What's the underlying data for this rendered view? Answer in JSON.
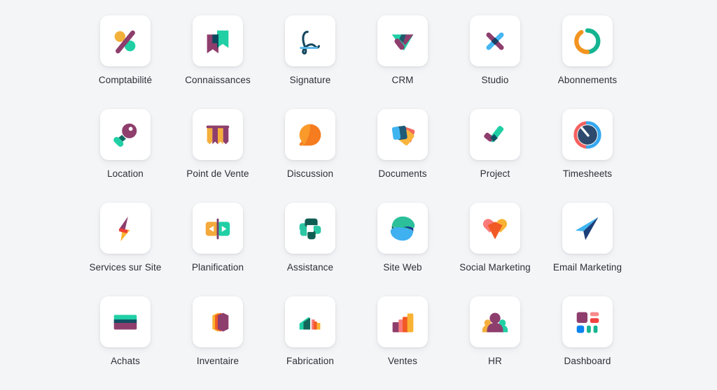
{
  "page": {
    "background_color": "#f4f5f7",
    "label_color": "#2b2f36",
    "tile_color": "#ffffff",
    "columns": 6,
    "rows": 4
  },
  "apps": [
    {
      "label": "Comptabilité",
      "icon": "accounting-percent-icon",
      "colors": [
        "#f2b13b",
        "#8e3e6d",
        "#21cfa5"
      ]
    },
    {
      "label": "Connaissances",
      "icon": "knowledge-bookmark-icon",
      "colors": [
        "#21cfa5",
        "#8e3e6d",
        "#0b4a5e"
      ]
    },
    {
      "label": "Signature",
      "icon": "signature-pen-icon",
      "colors": [
        "#14475e",
        "#5ab8ea"
      ]
    },
    {
      "label": "CRM",
      "icon": "crm-handshake-icon",
      "colors": [
        "#21cfa5",
        "#8e3e6d",
        "#1d5a6b"
      ]
    },
    {
      "label": "Studio",
      "icon": "studio-tools-icon",
      "colors": [
        "#8e3e6d",
        "#45b6f2",
        "#1b3f63"
      ]
    },
    {
      "label": "Abonnements",
      "icon": "subscriptions-loop-icon",
      "colors": [
        "#f2941f",
        "#14b491"
      ]
    },
    {
      "label": "Location",
      "icon": "rental-key-icon",
      "colors": [
        "#8e3e6d",
        "#21cfa5",
        "#0b6b63"
      ]
    },
    {
      "label": "Point de Vente",
      "icon": "pos-awning-icon",
      "colors": [
        "#f4ae3c",
        "#8e3e6d"
      ]
    },
    {
      "label": "Discussion",
      "icon": "discuss-bubble-icon",
      "colors": [
        "#f57c1f",
        "#f99a2b"
      ]
    },
    {
      "label": "Documents",
      "icon": "documents-cards-icon",
      "colors": [
        "#3fb5f0",
        "#1d5a78",
        "#f3675e",
        "#f9b43c"
      ]
    },
    {
      "label": "Project",
      "icon": "project-check-icon",
      "colors": [
        "#21cfa5",
        "#8e3e6d",
        "#0b5264"
      ]
    },
    {
      "label": "Timesheets",
      "icon": "timesheets-clock-icon",
      "colors": [
        "#f4615f",
        "#35a8f0",
        "#2d4a6e"
      ]
    },
    {
      "label": "Services sur Site",
      "icon": "field-service-bolt-icon",
      "colors": [
        "#8e3e6d",
        "#f9b233",
        "#ef3e36"
      ]
    },
    {
      "label": "Planification",
      "icon": "planning-slider-icon",
      "colors": [
        "#f4a93c",
        "#21cfa5",
        "#7a3e6d"
      ]
    },
    {
      "label": "Assistance",
      "icon": "helpdesk-cross-icon",
      "colors": [
        "#2bc7a4",
        "#0f5d52"
      ]
    },
    {
      "label": "Site Web",
      "icon": "website-lens-icon",
      "colors": [
        "#2bc09a",
        "#12665a",
        "#3fb0f0",
        "#173b8f"
      ]
    },
    {
      "label": "Social Marketing",
      "icon": "social-heart-icon",
      "colors": [
        "#f97a7a",
        "#f9b233",
        "#f15a24"
      ]
    },
    {
      "label": "Email Marketing",
      "icon": "email-plane-icon",
      "colors": [
        "#3fb5f0",
        "#1b3f7a",
        "#8e3e6d"
      ]
    },
    {
      "label": "Achats",
      "icon": "purchase-card-icon",
      "colors": [
        "#21cfa5",
        "#0f4f63",
        "#8e3e6d"
      ]
    },
    {
      "label": "Inventaire",
      "icon": "inventory-box-icon",
      "colors": [
        "#f9b233",
        "#f15a24",
        "#8e3e6d"
      ]
    },
    {
      "label": "Fabrication",
      "icon": "manufacturing-bars-icon",
      "colors": [
        "#21cfa5",
        "#12665a",
        "#f97a7a",
        "#f15a24",
        "#f9b233"
      ]
    },
    {
      "label": "Ventes",
      "icon": "sales-bars-icon",
      "colors": [
        "#8e3e6d",
        "#f97a7a",
        "#f15a24",
        "#f9b233"
      ]
    },
    {
      "label": "HR",
      "icon": "hr-people-icon",
      "colors": [
        "#8e3e6d",
        "#f4ae3c",
        "#21cfa5"
      ]
    },
    {
      "label": "Dashboard",
      "icon": "dashboard-tiles-icon",
      "colors": [
        "#8e3e6d",
        "#f98a8a",
        "#f2413f",
        "#0b84f0",
        "#14b491"
      ]
    }
  ]
}
